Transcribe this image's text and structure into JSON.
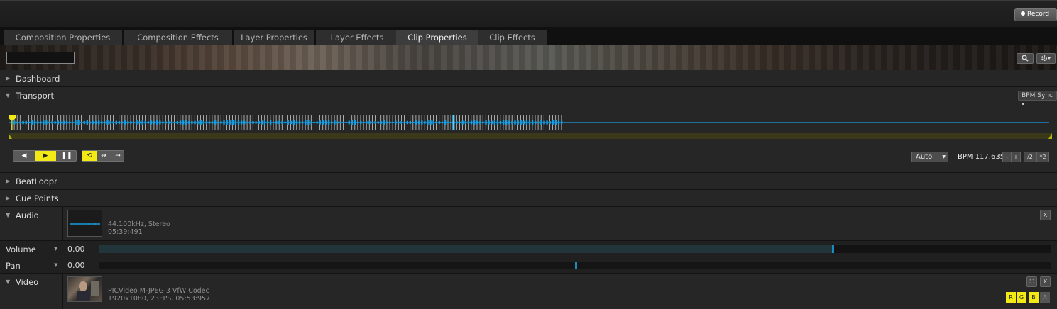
{
  "header": {
    "record_label": "Record"
  },
  "tabs": [
    {
      "label": "Composition Properties",
      "active": false
    },
    {
      "label": "Composition Effects",
      "active": false
    },
    {
      "label": "Layer Properties",
      "active": false
    },
    {
      "label": "Layer Effects",
      "active": false
    },
    {
      "label": "Clip Properties",
      "active": true
    },
    {
      "label": "Clip Effects",
      "active": false
    }
  ],
  "banner": {
    "search_value": "",
    "search_icon": "magnifier-icon",
    "settings_icon": "gear-icon"
  },
  "sections": {
    "dashboard": "Dashboard",
    "transport": "Transport",
    "beatloopr": "BeatLoopr",
    "cue_points": "Cue Points",
    "audio": "Audio",
    "video": "Video"
  },
  "transport": {
    "bpm_sync": "BPM Sync",
    "auto": "Auto",
    "bpm": "BPM 117.635",
    "minus": "-",
    "plus": "+",
    "half": "/2",
    "double": "*2",
    "playback_progress": 0.53
  },
  "audio": {
    "format": "44.100kHz, Stereo",
    "duration": "05:39:491",
    "close": "X"
  },
  "params": {
    "volume": {
      "label": "Volume",
      "value": "0.00",
      "level": 0.77
    },
    "pan": {
      "label": "Pan",
      "value": "0.00",
      "level": 0.5
    }
  },
  "video": {
    "codec": "PICVideo M-JPEG 3 VfW Codec",
    "info": "1920x1080, 23FPS, 05:53:957",
    "close": "X",
    "r": "R",
    "g": "G",
    "b": "B",
    "a": "A"
  },
  "colors": {
    "accent_yellow": "#f3e915",
    "wave_blue": "#1a9de0",
    "slider_blue": "#1a8cc0"
  }
}
